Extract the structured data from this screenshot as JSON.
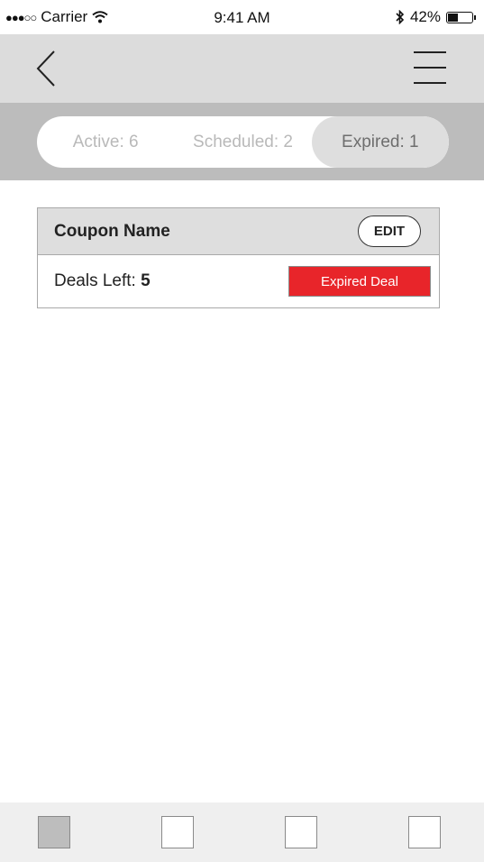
{
  "status_bar": {
    "signal": "●●●○○",
    "carrier": "Carrier",
    "time": "9:41 AM",
    "battery_percent": "42%",
    "battery_level": 0.42
  },
  "nav": {
    "back_icon": "chevron-left-icon",
    "menu_icon": "hamburger-menu-icon"
  },
  "segments": [
    {
      "label": "Active: 6",
      "selected": false
    },
    {
      "label": "Scheduled: 2",
      "selected": false
    },
    {
      "label": "Expired: 1",
      "selected": true
    }
  ],
  "coupon": {
    "name": "Coupon Name",
    "edit_label": "EDIT",
    "deals_left_label": "Deals Left:",
    "deals_left_value": "5",
    "status_label": "Expired Deal",
    "status_color": "#e8252a"
  },
  "tab_bar": {
    "tabs": [
      {
        "selected": true
      },
      {
        "selected": false
      },
      {
        "selected": false
      },
      {
        "selected": false
      }
    ]
  }
}
